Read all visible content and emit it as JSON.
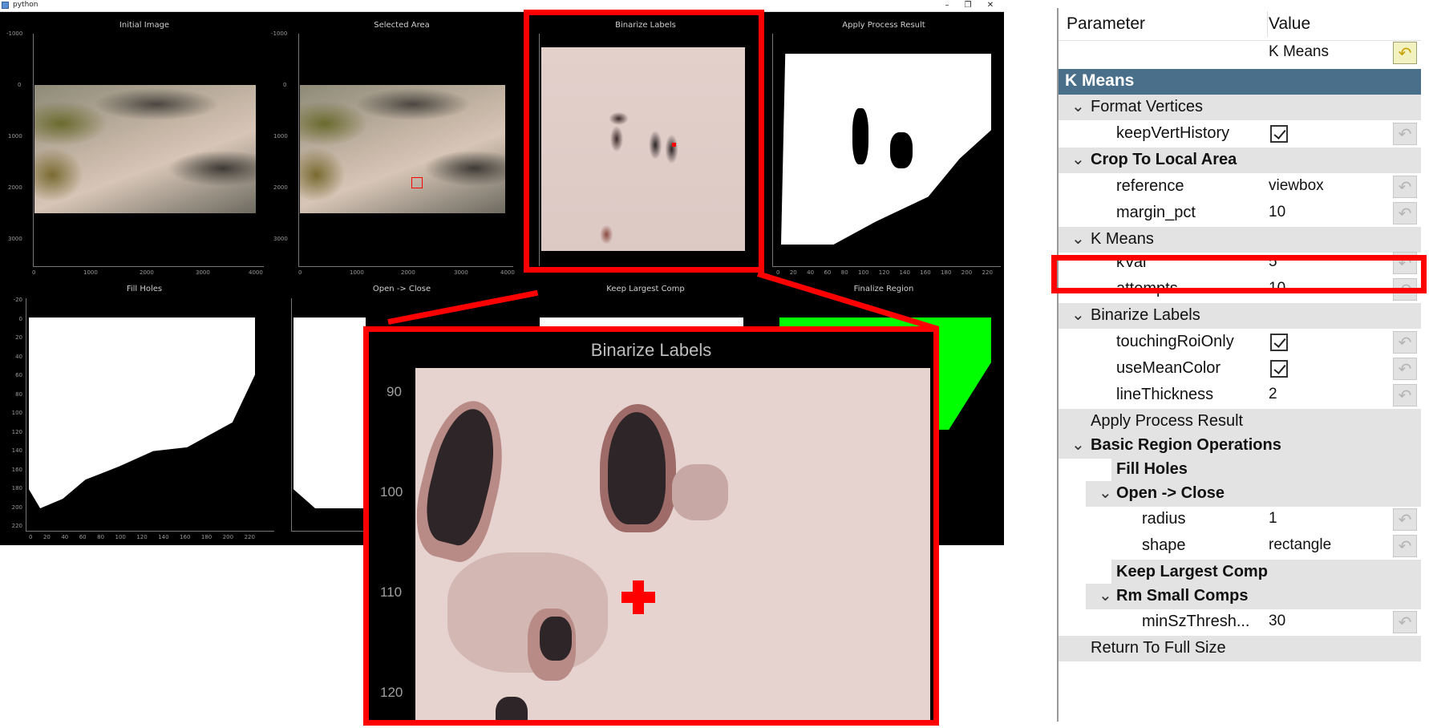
{
  "window": {
    "title": "python",
    "buttons": [
      "–",
      "❐",
      "✕"
    ]
  },
  "panels": {
    "row1": [
      "Initial Image",
      "Selected Area",
      "Binarize Labels",
      "Apply Process Result"
    ],
    "row2": [
      "Fill Holes",
      "Open -> Close",
      "Keep Largest Comp",
      "Finalize Region"
    ]
  },
  "ticks": {
    "img_y": [
      "-1000",
      "0",
      "1000",
      "2000",
      "3000"
    ],
    "img_x": [
      "0",
      "1000",
      "2000",
      "3000",
      "4000"
    ],
    "mask_y": [
      "-20",
      "0",
      "20",
      "40",
      "60",
      "80",
      "100",
      "120",
      "140",
      "160",
      "180",
      "200",
      "220"
    ],
    "mask_x": [
      "0",
      "20",
      "40",
      "60",
      "80",
      "100",
      "120",
      "140",
      "160",
      "180",
      "200",
      "220"
    ],
    "zoom_y": [
      "90",
      "100",
      "110",
      "120"
    ]
  },
  "zoom": {
    "title": "Binarize Labels"
  },
  "params": {
    "header_param": "Parameter",
    "header_value": "Value",
    "top_value": "K Means",
    "category": "K Means",
    "rows": [
      {
        "label": "Format Vertices"
      },
      {
        "label": "keepVertHistory"
      },
      {
        "label": "Crop To Local Area"
      },
      {
        "label": "reference",
        "value": "viewbox"
      },
      {
        "label": "margin_pct",
        "value": "10"
      },
      {
        "label": "K Means"
      },
      {
        "label": "kVal",
        "value": "5"
      },
      {
        "label": "attempts",
        "value": "10"
      },
      {
        "label": "Binarize Labels"
      },
      {
        "label": "touchingRoiOnly"
      },
      {
        "label": "useMeanColor"
      },
      {
        "label": "lineThickness",
        "value": "2"
      },
      {
        "label": "Apply Process Result"
      },
      {
        "label": "Basic Region Operations"
      },
      {
        "label": "Fill Holes"
      },
      {
        "label": "Open -> Close"
      },
      {
        "label": "radius",
        "value": "1"
      },
      {
        "label": "shape",
        "value": "rectangle"
      },
      {
        "label": "Keep Largest Comp"
      },
      {
        "label": "Rm Small Comps"
      },
      {
        "label": "minSzThresh...",
        "value": "30"
      },
      {
        "label": "Return To Full Size"
      }
    ]
  },
  "icons": {
    "expand": "chevron-down-icon",
    "reset": "undo-icon",
    "check": "checkmark-icon"
  },
  "colors": {
    "highlight": "#ff0000",
    "category_bg": "#4a6f8a",
    "finalize_mask": "#00ff00"
  }
}
